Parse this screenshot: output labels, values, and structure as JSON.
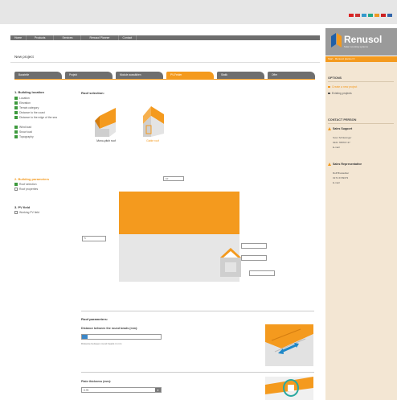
{
  "app": {
    "brand_name": "Renusol",
    "brand_sub": "Solar mounting systems",
    "logo_colors": [
      "#1f5fa8",
      "#f49a1e"
    ]
  },
  "top_bar": {
    "flags": [
      "de",
      "en",
      "fr",
      "it",
      "es",
      "nl",
      "cz"
    ],
    "flag_colors": [
      "#d22",
      "#c33",
      "#39c",
      "#2a8",
      "#e92",
      "#c22",
      "#36a"
    ]
  },
  "nav": {
    "items": [
      "Home",
      "Products",
      "Services",
      "Renusol Planner",
      "Contact"
    ]
  },
  "sidebar": {
    "strip_text": "Start - Renusol planner II",
    "options_title": "OPTIONS",
    "options": [
      {
        "label": "Create a new project",
        "active": true
      },
      {
        "label": "Existing projects",
        "active": false
      }
    ],
    "contact_title": "CONTACT PERSON",
    "contacts": [
      {
        "role": "Sales Support",
        "lines": [
          "Sven Schlesinger",
          "0221 788707-37",
          "E-mail"
        ]
      },
      {
        "role": "Sales Representative",
        "lines": [
          "Rolf Brekaußer",
          "0171 6729373",
          "E-mail"
        ]
      }
    ]
  },
  "project": {
    "title": "New project"
  },
  "tabs": [
    {
      "label": "Baustelle",
      "active": false
    },
    {
      "label": "Projekt",
      "active": false
    },
    {
      "label": "Module auswählen",
      "active": false
    },
    {
      "label": "PV-Felder",
      "active": true
    },
    {
      "label": "Statik",
      "active": false
    },
    {
      "label": "Offer",
      "active": false
    }
  ],
  "steps": {
    "sections": [
      {
        "title": "1. Building location",
        "state": "done",
        "items": [
          "Location",
          "Elevation",
          "Terrain category",
          "Distance to the coast",
          "Distance to the edge of the sea",
          "Wind load",
          "Snow load",
          "Topography"
        ]
      },
      {
        "title": "2. Building parameters",
        "state": "current",
        "items": [
          "Roof selection",
          "Roof properties"
        ]
      },
      {
        "title": "3. PV field",
        "state": "todo",
        "items": [
          "Working PV field"
        ]
      }
    ]
  },
  "roof_selection": {
    "title": "Roof selection:",
    "options": [
      {
        "label": "Mono-pitch roof",
        "selected": false
      },
      {
        "label": "Gable roof",
        "selected": true
      }
    ]
  },
  "drawing": {
    "dim_top": "10",
    "dim_left": "5",
    "dim_right_1": "",
    "dim_right_2": "",
    "dim_right_3": ""
  },
  "parameters": {
    "title": "Roof parameters:",
    "field1": {
      "label": "Distance between the round beads (mm):",
      "value": "",
      "hint": "Distance between round beads in mm"
    },
    "field2": {
      "label": "Plate thickness (mm):",
      "value": "0.75"
    }
  },
  "colors": {
    "accent": "#f49a1e",
    "dark_nav": "#6e6e6e",
    "sidebar_bg": "#f3e6d3",
    "check_green": "#3d9a3d"
  }
}
